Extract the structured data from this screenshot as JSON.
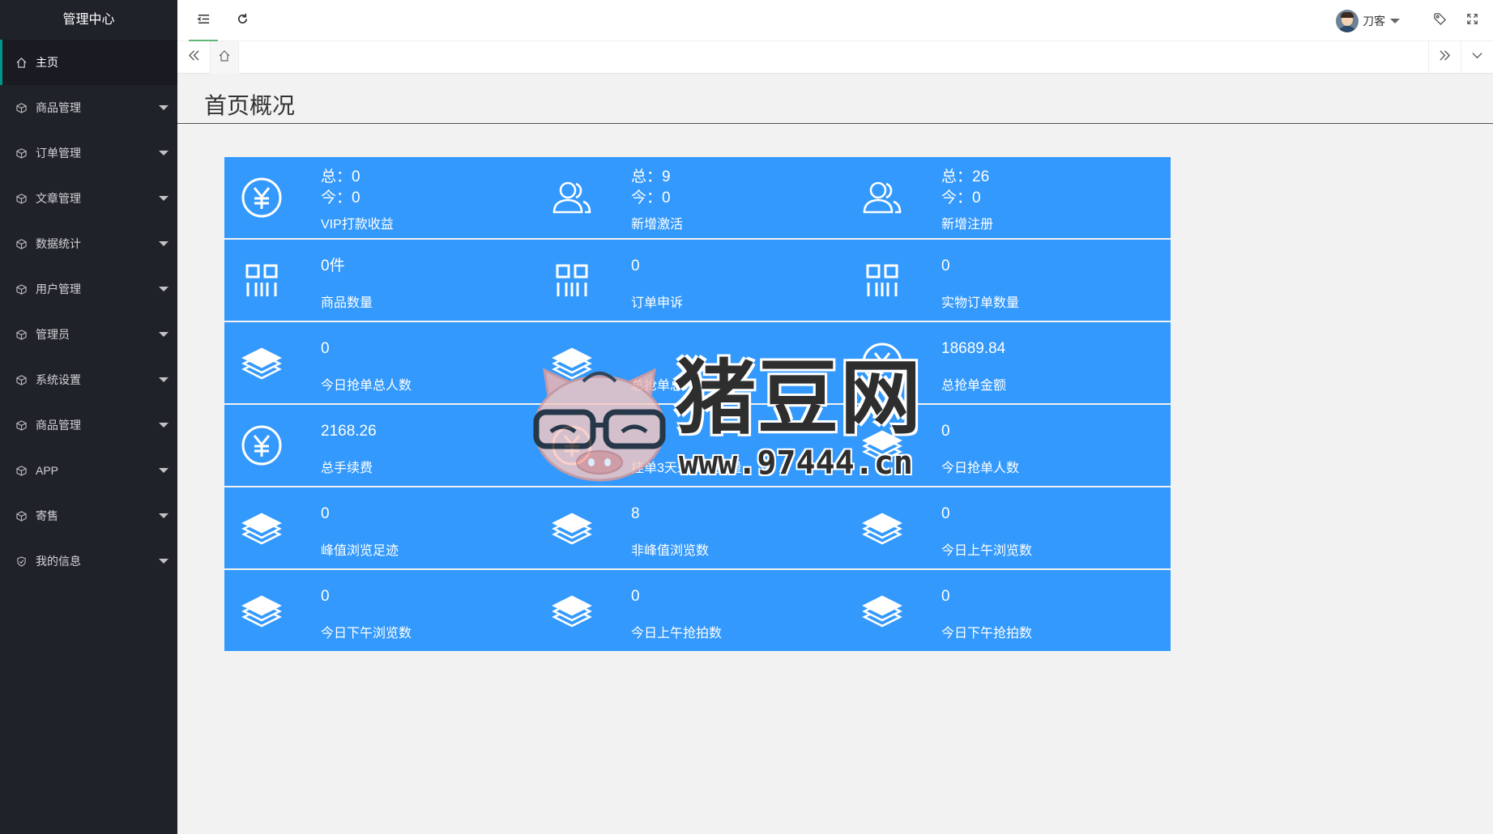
{
  "app": {
    "title": "管理中心"
  },
  "sidebar": {
    "items": [
      {
        "label": "主页",
        "icon": "home-icon",
        "active": true
      },
      {
        "label": "商品管理",
        "icon": "cube-icon"
      },
      {
        "label": "订单管理",
        "icon": "cube-icon"
      },
      {
        "label": "文章管理",
        "icon": "cube-icon"
      },
      {
        "label": "数据统计",
        "icon": "cube-icon"
      },
      {
        "label": "用户管理",
        "icon": "cube-icon"
      },
      {
        "label": "管理员",
        "icon": "cube-icon"
      },
      {
        "label": "系统设置",
        "icon": "cube-icon"
      },
      {
        "label": "商品管理",
        "icon": "cube-icon"
      },
      {
        "label": "APP",
        "icon": "cube-icon"
      },
      {
        "label": "寄售",
        "icon": "cube-icon"
      },
      {
        "label": "我的信息",
        "icon": "shield-icon"
      }
    ]
  },
  "header": {
    "user_name": "刀客"
  },
  "main": {
    "page_title": "首页概况"
  },
  "cards": [
    {
      "icon": "yuan-icon",
      "total": "总：0",
      "today": "今：0",
      "label": "VIP打款收益"
    },
    {
      "icon": "users-icon",
      "total": "总：9",
      "today": "今：0",
      "label": "新增激活"
    },
    {
      "icon": "users-icon",
      "total": "总：26",
      "today": "今：0",
      "label": "新增注册"
    },
    {
      "icon": "barcode-icon",
      "value": "0件",
      "label": "商品数量"
    },
    {
      "icon": "barcode-icon",
      "value": "0",
      "label": "订单申诉"
    },
    {
      "icon": "barcode-icon",
      "value": "0",
      "label": "实物订单数量"
    },
    {
      "icon": "layers-icon",
      "value": "0",
      "label": "今日抢单总人数"
    },
    {
      "icon": "layers-icon",
      "value": "",
      "label": "总抢单总人"
    },
    {
      "icon": "yuan-icon",
      "value": "18689.84",
      "label": "总抢单金额"
    },
    {
      "icon": "yuan-icon",
      "value": "2168.26",
      "label": "总手续费"
    },
    {
      "icon": "yuan-icon",
      "value": "",
      "label": "挂单3天未成交数量"
    },
    {
      "icon": "layers-icon",
      "value": "0",
      "label": "今日抢单人数"
    },
    {
      "icon": "layers-icon",
      "value": "0",
      "label": "峰值浏览足迹"
    },
    {
      "icon": "layers-icon",
      "value": "8",
      "label": "非峰值浏览数"
    },
    {
      "icon": "layers-icon",
      "value": "0",
      "label": "今日上午浏览数"
    },
    {
      "icon": "layers-icon",
      "value": "0",
      "label": "今日下午浏览数"
    },
    {
      "icon": "layers-icon",
      "value": "0",
      "label": "今日上午抢拍数"
    },
    {
      "icon": "layers-icon",
      "value": "0",
      "label": "今日下午抢拍数"
    }
  ],
  "watermark": {
    "title": "猪豆网",
    "url": "www.97444.cn"
  },
  "colors": {
    "sidebar_bg": "#20222a",
    "card_bg": "#3399fc",
    "active_accent": "#009688"
  }
}
